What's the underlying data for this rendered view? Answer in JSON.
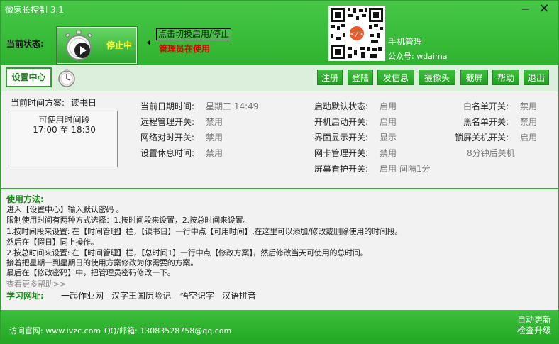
{
  "window": {
    "title": "微家长控制 3.1",
    "minimize": "−",
    "close": "✕"
  },
  "header": {
    "status_label": "当前状态:",
    "status_text": "停止中",
    "toggle_link": "点击切换启用/停止",
    "admin_text": "管理员在使用",
    "phone_label": "手机管理",
    "wechat_label": "公众号: wdaima"
  },
  "toolbar": {
    "settings_tab": "设置中心",
    "buttons": [
      "注册",
      "登陆",
      "发信息",
      "摄像头",
      "截屏",
      "帮助",
      "退出"
    ]
  },
  "info": {
    "plan_label": "当前时间方案:",
    "plan_value": "读书日",
    "period_title": "可使用时间段",
    "period_time": "17:00 至 18:30",
    "col1": [
      {
        "label": "当前日期时间:",
        "value": "星期三   14:49"
      },
      {
        "label": "远程管理开关:",
        "value": "禁用"
      },
      {
        "label": "网络对时开关:",
        "value": "禁用"
      },
      {
        "label": "设置休息时间:",
        "value": "禁用"
      }
    ],
    "col2": [
      {
        "label": "启动默认状态:",
        "value": "启用"
      },
      {
        "label": "开机启动开关:",
        "value": "启用"
      },
      {
        "label": "界面显示开关:",
        "value": "显示"
      },
      {
        "label": "网卡管理开关:",
        "value": "禁用"
      },
      {
        "label": "屏幕看护开关:",
        "value": "启用  间隔1分"
      }
    ],
    "col3": [
      {
        "label": "白名单开关:",
        "value": "禁用"
      },
      {
        "label": "黑名单开关:",
        "value": "禁用"
      },
      {
        "label": "锁屏关机开关:",
        "value": "启用"
      }
    ],
    "shutdown_note": "8分钟后关机"
  },
  "usage": {
    "title": "使用方法:",
    "lines": [
      "进入【设置中心】输入默认密码 。",
      "限制使用时间有两种方式选择：1.按时间段来设置，2.按总时间来设置。",
      "1.按时间段来设置: 在【时间管理】栏，【读书日】一行中点【可用时间】,在这里可以添加/修改或删除使用的时间段。",
      "然后在【假日】同上操作。",
      "2.按总时间来设置: 在【时间管理】栏，【总时间1】一行中点【修改方案】，然后修改当天可使用的总时间。",
      "接着把星期一到星期日的使用方案修改为你需要的方案。",
      "最后在【修改密码】中，把管理员密码修改一下。"
    ],
    "more_help": "查看更多帮助>>",
    "learn_label": "学习网址:",
    "learn_links": [
      "一起作业网",
      "汉字王国历险记",
      "悟空识字",
      "汉语拼音"
    ]
  },
  "footer": {
    "site": "访问官网: www.ivzc.com",
    "qq": "QQ/邮箱: 13083528758@qq.com",
    "auto_update": "自动更新",
    "check_upgrade": "检查升级"
  },
  "colors": {
    "brand_green": "#2fb32f",
    "status_yellow": "#ffff33",
    "admin_red": "#e00000"
  }
}
